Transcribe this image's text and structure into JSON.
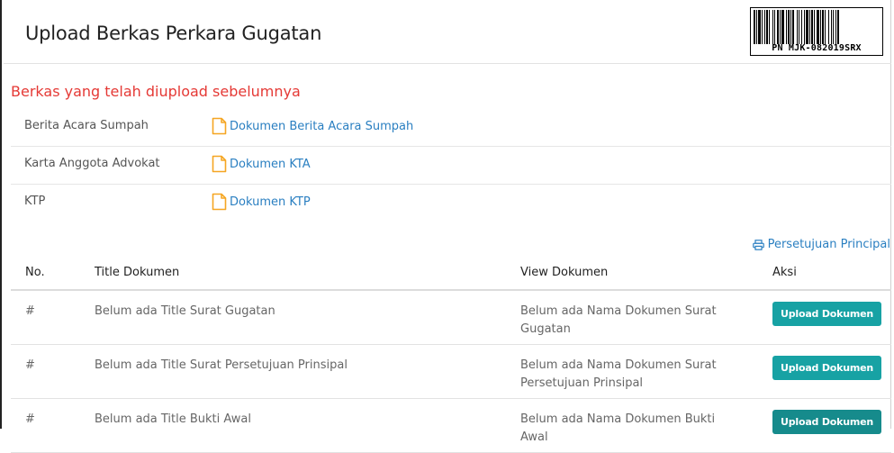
{
  "page": {
    "title": "Upload Berkas Perkara Gugatan"
  },
  "barcode": {
    "text": "PN MJK-082019SRX"
  },
  "uploaded": {
    "heading": "Berkas yang telah diupload sebelumnya",
    "items": [
      {
        "label": "Berita Acara Sumpah",
        "link": "Dokumen Berita Acara Sumpah",
        "icon": "file-icon"
      },
      {
        "label": "Karta Anggota Advokat",
        "link": "Dokumen KTA",
        "icon": "file-icon"
      },
      {
        "label": "KTP",
        "link": "Dokumen KTP",
        "icon": "file-icon"
      }
    ]
  },
  "print_link": {
    "label": "Persetujuan Principal",
    "icon": "print-icon"
  },
  "table": {
    "headers": {
      "no": "No.",
      "title": "Title Dokumen",
      "view": "View Dokumen",
      "aksi": "Aksi"
    },
    "rows": [
      {
        "no": "#",
        "title": "Belum ada Title Surat Gugatan",
        "view": "Belum ada Nama Dokumen Surat Gugatan",
        "action": "Upload Dokumen"
      },
      {
        "no": "#",
        "title": "Belum ada Title Surat Persetujuan Prinsipal",
        "view": "Belum ada Nama Dokumen Surat Persetujuan Prinsipal",
        "action": "Upload Dokumen"
      },
      {
        "no": "#",
        "title": "Belum ada Title Bukti Awal",
        "view": "Belum ada Nama Dokumen Bukti Awal",
        "action": "Upload Dokumen"
      }
    ]
  },
  "colors": {
    "heading_red": "#e53935",
    "link_blue": "#2a7fc1",
    "button_teal": "#17a2a4",
    "file_icon_orange": "#f5a623"
  }
}
